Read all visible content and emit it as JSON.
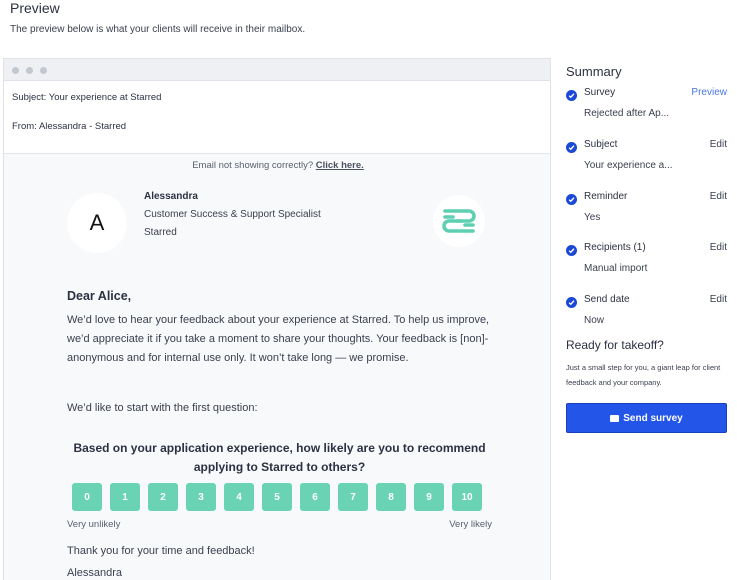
{
  "header": {
    "title": "Preview",
    "subtitle": "The preview below is what your clients will receive in their mailbox."
  },
  "email": {
    "subject_key": "Subject:",
    "subject_value": "Your experience at Starred",
    "from_key": "From:",
    "from_value": "Alessandra - Starred",
    "not_showing_text": "Email not showing correctly?",
    "not_showing_link": "Click here.",
    "sender": {
      "avatar_letter": "A",
      "name": "Alessandra",
      "role": "Customer Success & Support Specialist",
      "company": "Starred"
    },
    "greeting": "Dear Alice,",
    "intro": "We’d love to hear your feedback about your experience at Starred. To help us im­prove, we’d appreciate it if you take a moment to share your thoughts. Your feed­back is [non]-anonymous and for internal use only. It won’t take long — we prom­ise.",
    "start_question": "We’d like to start with the first question:",
    "question": "Based on your application experience, how likely are you to recom­mend applying to Starred to others?",
    "scale": [
      "0",
      "1",
      "2",
      "3",
      "4",
      "5",
      "6",
      "7",
      "8",
      "9",
      "10"
    ],
    "scale_low": "Very unlikely",
    "scale_high": "Very likely",
    "thanks": "Thank you for your time and feedback!",
    "signoff": "Alessandra"
  },
  "summary": {
    "title": "Summary",
    "items": [
      {
        "label": "Survey",
        "action": "Preview",
        "value": "Rejected after Ap..."
      },
      {
        "label": "Subject",
        "action": "Edit",
        "value": "Your experience a..."
      },
      {
        "label": "Reminder",
        "action": "Edit",
        "value": "Yes"
      },
      {
        "label": "Recipients (1)",
        "action": "Edit",
        "value": "Manual import"
      },
      {
        "label": "Send date",
        "action": "Edit",
        "value": "Now"
      }
    ],
    "takeoff_title": "Ready for takeoff?",
    "takeoff_desc": "Just a small step for you, a giant leap for client feedback and your company.",
    "send_label": "Send survey"
  },
  "colors": {
    "accent": "#2255e8",
    "scale_button": "#6ad3b4",
    "check": "#1b48d6",
    "preview_link": "#4a77e6"
  }
}
